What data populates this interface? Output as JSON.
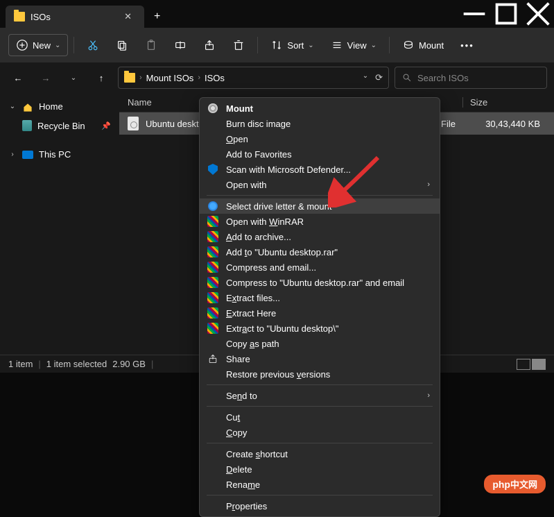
{
  "titlebar": {
    "tab": "ISOs"
  },
  "toolbar": {
    "new": "New",
    "sort": "Sort",
    "view": "View",
    "mount": "Mount"
  },
  "breadcrumb": {
    "seg1": "Mount ISOs",
    "seg2": "ISOs"
  },
  "search": {
    "placeholder": "Search ISOs"
  },
  "sidebar": {
    "home": "Home",
    "recycle": "Recycle Bin",
    "pc": "This PC"
  },
  "columns": {
    "name": "Name",
    "size": "Size"
  },
  "file": {
    "name": "Ubuntu desktop.",
    "type": "e File",
    "size": "30,43,440 KB"
  },
  "status": {
    "count": "1 item",
    "selected": "1 item selected",
    "size": "2.90 GB"
  },
  "ctx": {
    "mount": "Mount",
    "burn": "Burn disc image",
    "open": "Open",
    "fav": "Add to Favorites",
    "defender": "Scan with Microsoft Defender...",
    "openwith": "Open with",
    "select_mount": "Select drive letter & mount",
    "winrar": "Open with WinRAR",
    "addarchive": "Add to archive...",
    "addto": "Add to \"Ubuntu desktop.rar\"",
    "compress_email": "Compress and email...",
    "compress_to_email": "Compress to \"Ubuntu desktop.rar\" and email",
    "extract_files": "Extract files...",
    "extract_here": "Extract Here",
    "extract_to": "Extract to \"Ubuntu desktop\\\"",
    "copypath": "Copy as path",
    "share": "Share",
    "restore": "Restore previous versions",
    "sendto": "Send to",
    "cut": "Cut",
    "copy": "Copy",
    "shortcut": "Create shortcut",
    "delete": "Delete",
    "rename": "Rename",
    "properties": "Properties"
  },
  "watermark": "中文网"
}
